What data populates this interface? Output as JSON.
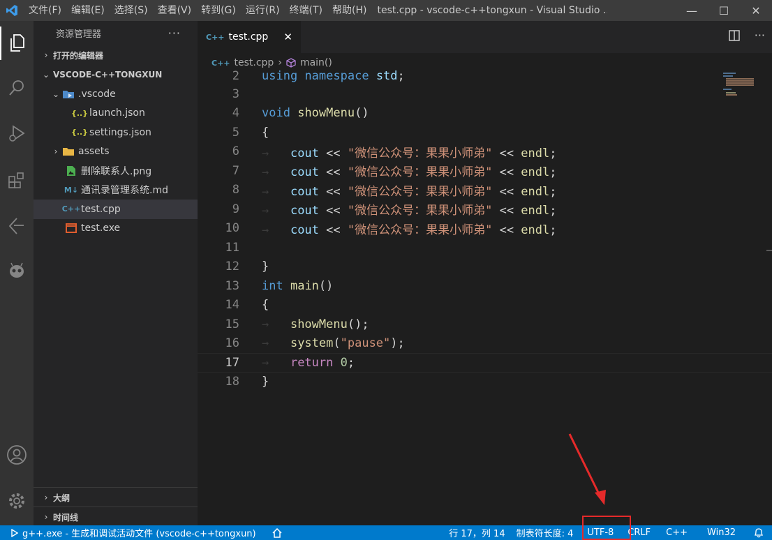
{
  "titlebar": {
    "menus": [
      "文件(F)",
      "编辑(E)",
      "选择(S)",
      "查看(V)",
      "转到(G)",
      "运行(R)",
      "终端(T)",
      "帮助(H)"
    ],
    "title": "test.cpp - vscode-c++tongxun - Visual Studio ...",
    "controls": [
      "—",
      "☐",
      "✕"
    ]
  },
  "sidebar": {
    "header": "资源管理器",
    "more": "···",
    "open_editors": "打开的编辑器",
    "project": "VSCODE-C++TONGXUN",
    "tree": [
      {
        "label": ".vscode",
        "icon": "vscode-folder-icon"
      },
      {
        "label": "launch.json",
        "icon": "json-icon"
      },
      {
        "label": "settings.json",
        "icon": "json-icon"
      },
      {
        "label": "assets",
        "icon": "folder-icon"
      },
      {
        "label": "删除联系人.png",
        "icon": "image-icon"
      },
      {
        "label": "通讯录管理系统.md",
        "icon": "markdown-icon"
      },
      {
        "label": "test.cpp",
        "icon": "cpp-icon"
      },
      {
        "label": "test.exe",
        "icon": "exe-icon"
      }
    ],
    "outline": "大纲",
    "timeline": "时间线"
  },
  "tabs": {
    "active": "test.cpp",
    "close": "✕"
  },
  "breadcrumb": {
    "file": "test.cpp",
    "symbol": "main()"
  },
  "editor": {
    "line_numbers": [
      "2",
      "3",
      "4",
      "5",
      "6",
      "7",
      "8",
      "9",
      "10",
      "11",
      "12",
      "13",
      "14",
      "15",
      "16",
      "17",
      "18"
    ],
    "string_literal": "\"微信公众号：果果小师弟\"",
    "pause_literal": "\"pause\"",
    "return_value": "0"
  },
  "statusbar": {
    "task": "g++.exe - 生成和调试活动文件 (vscode-c++tongxun)",
    "position": "行 17，列 14",
    "indent": "制表符长度: 4",
    "encoding": "UTF-8",
    "eol": "CRLF",
    "language": "C++",
    "platform": "Win32"
  },
  "colors": {
    "accent": "#007acc",
    "annotation": "#e52a2a"
  }
}
